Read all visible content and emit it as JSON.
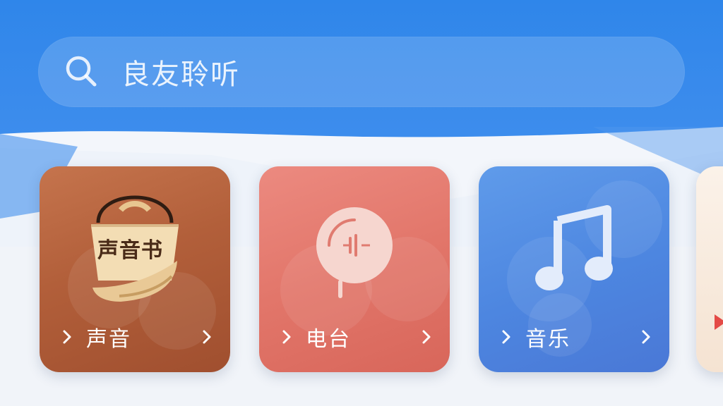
{
  "search": {
    "placeholder_text": "良友聆听",
    "icon": "search-icon"
  },
  "cards": [
    {
      "label": "声音",
      "icon": "book-bucket-icon",
      "icon_text": "声音书",
      "color": "#b25f3a"
    },
    {
      "label": "电台",
      "icon": "radio-microphone-icon",
      "color": "#e2766a"
    },
    {
      "label": "音乐",
      "icon": "music-note-icon",
      "color": "#4d86e0"
    }
  ],
  "colors": {
    "header": "#2f86ea",
    "background": "#f1f4f9"
  }
}
